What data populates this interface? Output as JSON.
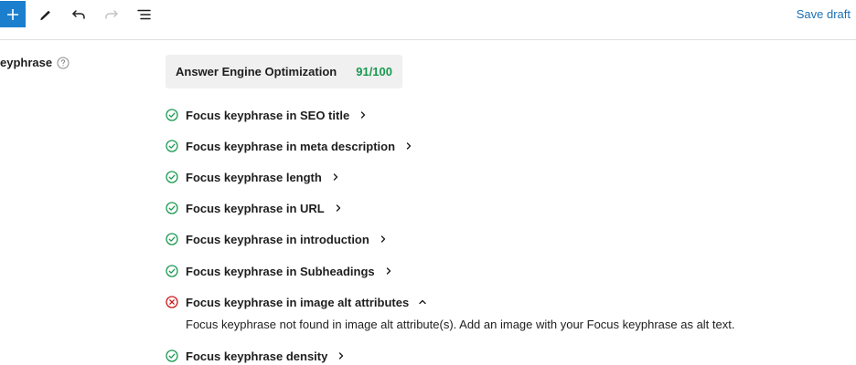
{
  "toolbar": {
    "add_icon": "plus-icon",
    "edit_icon": "pencil-icon",
    "undo_icon": "undo-icon",
    "redo_icon": "redo-icon",
    "outline_icon": "list-view-icon",
    "save_label": "Save draft",
    "accent": "#1b7fce"
  },
  "sidebar": {
    "keyphrase_label": "eyphrase",
    "help_icon": "question-circle-icon"
  },
  "score": {
    "title": "Answer Engine Optimization",
    "value": "91/100",
    "value_color": "#1a9950"
  },
  "checks": [
    {
      "label": "Focus keyphrase in SEO title",
      "status": "pass",
      "expanded": false
    },
    {
      "label": "Focus keyphrase in meta description",
      "status": "pass",
      "expanded": false
    },
    {
      "label": "Focus keyphrase length",
      "status": "pass",
      "expanded": false
    },
    {
      "label": "Focus keyphrase in URL",
      "status": "pass",
      "expanded": false
    },
    {
      "label": "Focus keyphrase in introduction",
      "status": "pass",
      "expanded": false
    },
    {
      "label": "Focus keyphrase in Subheadings",
      "status": "pass",
      "expanded": false
    },
    {
      "label": "Focus keyphrase in image alt attributes",
      "status": "fail",
      "expanded": true,
      "description": "Focus keyphrase not found in image alt attribute(s). Add an image with your Focus keyphrase as alt text."
    },
    {
      "label": "Focus keyphrase density",
      "status": "pass",
      "expanded": false
    }
  ],
  "colors": {
    "pass": "#1a9950",
    "fail": "#cc1818"
  }
}
